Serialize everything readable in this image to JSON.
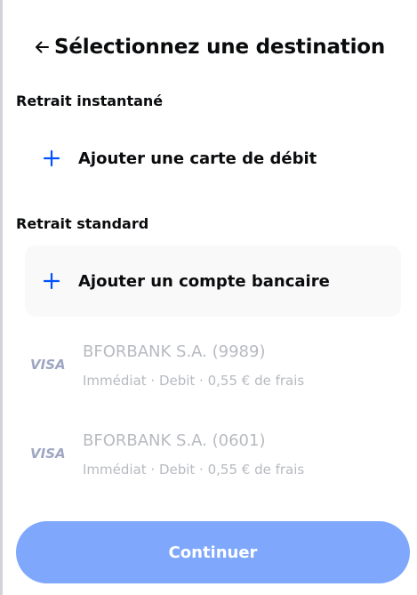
{
  "header": {
    "back_icon": "arrow-left-icon",
    "title": "Sélectionnez une destination"
  },
  "instant_section": {
    "label": "Retrait instantané",
    "add_card_label": "Ajouter une carte de débit",
    "add_card_icon": "plus-icon"
  },
  "standard_section": {
    "label": "Retrait standard",
    "add_bank_label": "Ajouter un compte bancaire",
    "add_bank_icon": "plus-icon",
    "accounts": [
      {
        "logo": "VISA",
        "name": "BFORBANK S.A. (9989)",
        "detail": "Immédiat · Debit · 0,55 € de frais"
      },
      {
        "logo": "VISA",
        "name": "BFORBANK S.A. (0601)",
        "detail": "Immédiat · Debit · 0,55 € de frais"
      }
    ]
  },
  "footer": {
    "continue_label": "Continuer"
  },
  "colors": {
    "accent_blue": "#0052ff",
    "button_disabled_blue": "#7fa8fc",
    "disabled_text": "#b7bac0",
    "visa_logo": "#9ea6c2",
    "highlight_bg": "#f9f9fa"
  }
}
